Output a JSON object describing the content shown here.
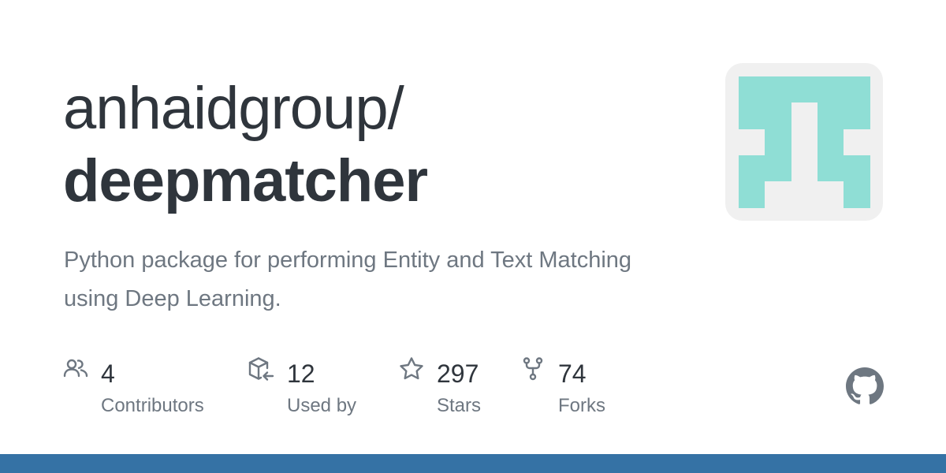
{
  "repo": {
    "owner": "anhaidgroup/",
    "name": "deepmatcher",
    "description": "Python package for performing Entity and Text Matching using Deep Learning."
  },
  "stats": [
    {
      "icon": "people-icon",
      "value": "4",
      "label": "Contributors"
    },
    {
      "icon": "package-dependents-icon",
      "value": "12",
      "label": "Used by"
    },
    {
      "icon": "star-icon",
      "value": "297",
      "label": "Stars"
    },
    {
      "icon": "repo-forked-icon",
      "value": "74",
      "label": "Forks"
    }
  ],
  "colors": {
    "avatar_fg": "#8fded5",
    "avatar_bg": "#f0f0f0",
    "language_bar": "#3572a5",
    "icon": "#6e7781"
  },
  "icons": {
    "brand": "github-mark-icon",
    "avatar": "identicon-avatar"
  }
}
